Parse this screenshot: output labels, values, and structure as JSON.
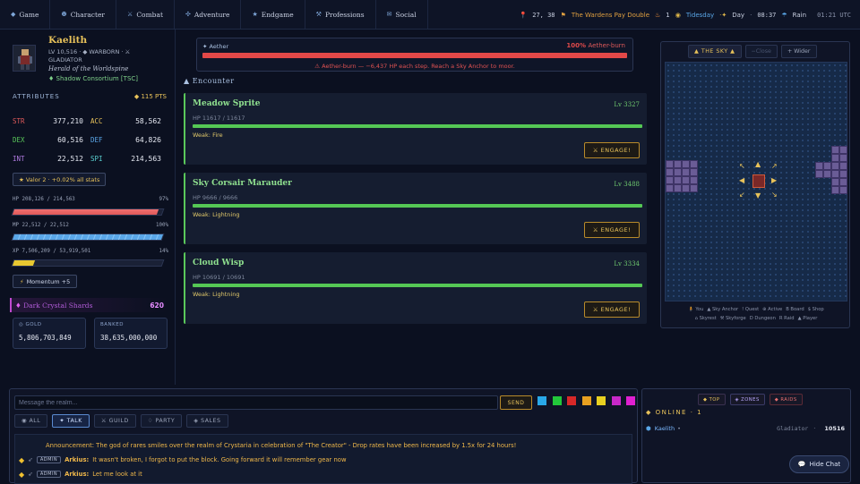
{
  "nav": {
    "items": [
      {
        "icon": "diamond-icon",
        "glyph": "◆",
        "label": "Game"
      },
      {
        "icon": "character-icon",
        "glyph": "☻",
        "label": "Character"
      },
      {
        "icon": "swords-icon",
        "glyph": "⚔",
        "label": "Combat"
      },
      {
        "icon": "compass-icon",
        "glyph": "✣",
        "label": "Adventure"
      },
      {
        "icon": "star-icon",
        "glyph": "★",
        "label": "Endgame"
      },
      {
        "icon": "tools-icon",
        "glyph": "⚒",
        "label": "Professions"
      },
      {
        "icon": "chat-icon",
        "glyph": "✉",
        "label": "Social"
      }
    ],
    "coords": "27, 38",
    "event": "The Wardens Pay Double",
    "streak": "1",
    "day_name": "Tidesday",
    "phase": "Day",
    "time": "08:37",
    "weather": "Rain",
    "utc": "01:21 UTC"
  },
  "player": {
    "name": "Kaelith",
    "subline": "LV 10,516 · ◆ WARBORN · ⚔ GLADIATOR",
    "title": "Herald of the Worldspine",
    "guild": "♦ Shadow Consortium [TSC]"
  },
  "attributes": {
    "heading": "ATTRIBUTES",
    "points": "◆ 115 PTS",
    "rows": [
      [
        {
          "label": "STR",
          "value": "377,210",
          "color": "#e05a5a"
        },
        {
          "label": "ACC",
          "value": "58,562",
          "color": "#e8c25a"
        }
      ],
      [
        {
          "label": "DEX",
          "value": "60,516",
          "color": "#5ac85a"
        },
        {
          "label": "DEF",
          "value": "64,826",
          "color": "#5aa7e8"
        }
      ],
      [
        {
          "label": "INT",
          "value": "22,512",
          "color": "#b07ae0"
        },
        {
          "label": "SPI",
          "value": "214,563",
          "color": "#5ad0d0"
        }
      ]
    ],
    "valor": "★ Valor 2 · +0.02% all stats"
  },
  "bars": {
    "hp": {
      "label": "HP 208,126 / 214,563",
      "pct_label": "97%",
      "pct": 97,
      "color": "#e05858"
    },
    "mp": {
      "label": "MP 22,512 / 22,512",
      "pct_label": "100%",
      "pct": 100,
      "color": "#5aa7e8"
    },
    "xp": {
      "label": "XP 7,506,209 / 53,919,501",
      "pct_label": "14%",
      "pct": 14,
      "color": "#e8c830"
    }
  },
  "momentum": "Momentum +5",
  "shards": {
    "label": "Dark Crystal Shards",
    "value": "620"
  },
  "wallet": {
    "gold": {
      "label": "◎ GOLD",
      "value": "5,806,703,849"
    },
    "banked": {
      "label": "BANKED",
      "value": "38,635,000,000"
    }
  },
  "aether": {
    "title": "✦ Aether",
    "status_pct": "100%",
    "status_label": "Aether-burn",
    "pct": 100,
    "message": "⚠ Aether-burn — −6,437 HP each step. Reach a Sky Anchor to moor."
  },
  "encounter": {
    "heading": "▲ Encounter",
    "monsters": [
      {
        "name": "Meadow Sprite",
        "level": "Lv 3327",
        "hp": "HP 11617 / 11617",
        "hp_pct": 100,
        "weak_label": "Weak:",
        "weak": "Fire",
        "button": "⚔ ENGAGE!"
      },
      {
        "name": "Sky Corsair Marauder",
        "level": "Lv 3488",
        "hp": "HP 9666 / 9666",
        "hp_pct": 100,
        "weak_label": "Weak:",
        "weak": "Lightning",
        "button": "⚔ ENGAGE!"
      },
      {
        "name": "Cloud Wisp",
        "level": "Lv 3334",
        "hp": "HP 10691 / 10691",
        "hp_pct": 100,
        "weak_label": "Weak:",
        "weak": "Lightning",
        "button": "⚔ ENGAGE!"
      }
    ]
  },
  "sky": {
    "tabs": [
      "▲ THE SKY ▲",
      "−Close",
      "+ Wider"
    ],
    "legend_line1": [
      "🧍 You",
      "▲ Sky Anchor",
      "! Quest",
      "⊕ Active",
      "B Board",
      "$ Shop"
    ],
    "legend_line2": [
      "⌂ Skyrest",
      "⚒ Skyforge",
      "D Dungeon",
      "R Raid",
      "▲ Player"
    ]
  },
  "chat": {
    "placeholder": "Message the realm...",
    "send": "SEND",
    "swatches": [
      "#29a8e8",
      "#22c83a",
      "#d82828",
      "#e8a020",
      "#e8d020",
      "#c828c8",
      "#e020d0"
    ],
    "tabs": [
      "◉ ALL",
      "✦ TALK",
      "⚔ GUILD",
      "♢ PARTY",
      "◈ SALES"
    ],
    "messages": [
      {
        "type": "announce",
        "text": "Announcement: The god of rares smiles over the realm of Crystaria in celebration of \"The Creator\" - Drop rates have been increased by 1.5x for 24 hours!"
      },
      {
        "type": "user",
        "badge": "ADMIN",
        "name": "Arkius:",
        "text": "It wasn't broken, I forgot to put the block. Going forward it will remember gear now"
      },
      {
        "type": "user",
        "badge": "ADMIN",
        "name": "Arkius:",
        "text": "Let me look at it"
      }
    ]
  },
  "online": {
    "tabs": [
      "◆ TOP",
      "◈ ZONES",
      "◆ RAIDS"
    ],
    "heading": "◆ ONLINE · 1",
    "player": {
      "name": "Kaelith",
      "status": "•",
      "class": "Gladiator",
      "sep": "·",
      "level": "10516"
    }
  },
  "hide_chat": "Hide Chat"
}
